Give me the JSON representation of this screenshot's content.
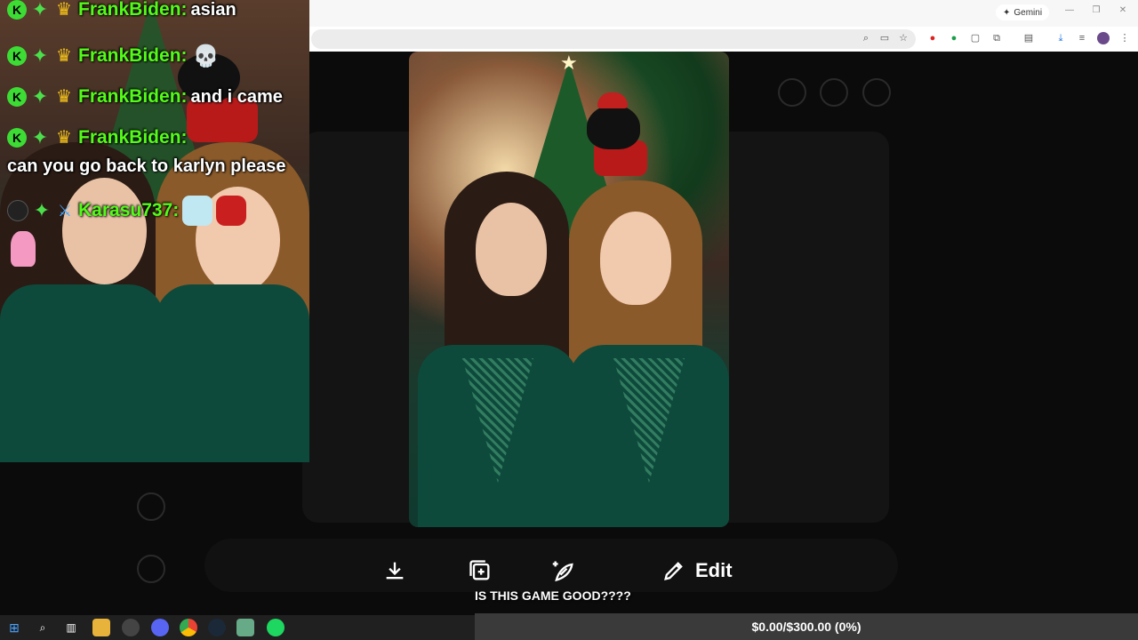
{
  "browser": {
    "gemini_label": "Gemini",
    "window_controls": [
      "—",
      "❒",
      "✕"
    ]
  },
  "chat": {
    "messages": [
      {
        "username": "FrankBiden:",
        "text": "asian"
      },
      {
        "username": "FrankBiden:",
        "text": ""
      },
      {
        "username": "FrankBiden:",
        "text": "and i came"
      },
      {
        "username": "FrankBiden:",
        "text": ""
      },
      {
        "username": "",
        "text": "can you go back to karlyn please"
      },
      {
        "username": "Karasu737:",
        "text": ""
      }
    ]
  },
  "actions": {
    "edit_label": "Edit"
  },
  "stream": {
    "caption": "IS THIS GAME GOOD????",
    "donation_goal": "$0.00/$300.00 (0%)"
  },
  "icons": {
    "download": "download-icon",
    "add": "add-to-collection-icon",
    "remix": "sparkle-leaf-icon",
    "edit": "pencil-icon"
  },
  "colors": {
    "chat_username": "#53fc18",
    "kick_badge": "#3ddc35",
    "page_bg": "#0b0b0b"
  }
}
